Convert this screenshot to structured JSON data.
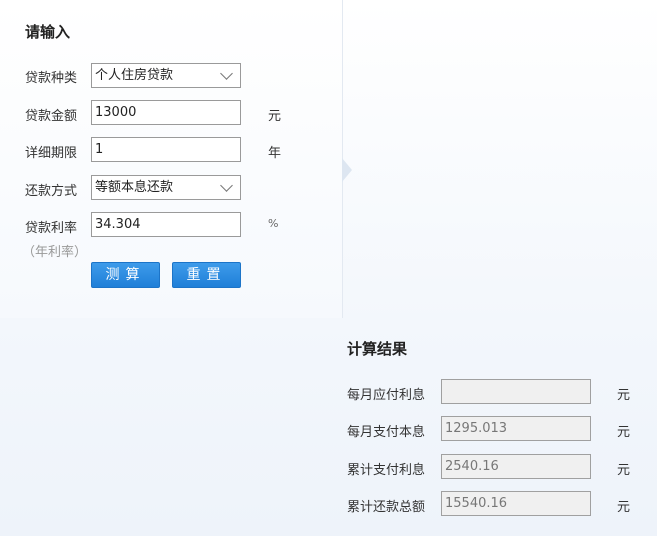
{
  "input": {
    "title": "请输入",
    "loan_type": {
      "label": "贷款种类",
      "value": "个人住房贷款"
    },
    "amount": {
      "label": "贷款金额",
      "value": "13000",
      "unit": "元"
    },
    "term": {
      "label": "详细期限",
      "value": "1",
      "unit": "年"
    },
    "method": {
      "label": "还款方式",
      "value": "等额本息还款"
    },
    "rate": {
      "label": "贷款利率",
      "sub": "（年利率）",
      "value": "34.304",
      "unit": "%"
    },
    "calc_label": "测算",
    "reset_label": "重置"
  },
  "result": {
    "title": "计算结果",
    "rows": [
      {
        "label": "每月应付利息",
        "value": "",
        "unit": "元"
      },
      {
        "label": "每月支付本息",
        "value": "1295.013",
        "unit": "元"
      },
      {
        "label": "累计支付利息",
        "value": "2540.16",
        "unit": "元"
      },
      {
        "label": "累计还款总额",
        "value": "15540.16",
        "unit": "元"
      }
    ]
  }
}
